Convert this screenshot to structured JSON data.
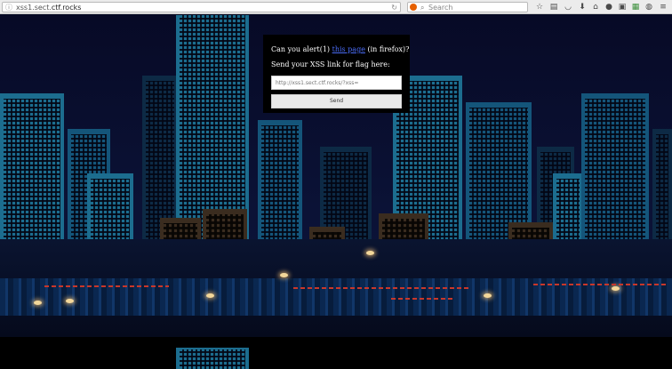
{
  "browser": {
    "url_prefix": "xss1.sect.",
    "url_domain": "ctf.rocks",
    "search_placeholder": "Search"
  },
  "form": {
    "question_before": "Can you alert(1)",
    "question_link": "this page",
    "question_after": "(in firefox)?",
    "prompt": "Send your XSS link for flag here:",
    "input_placeholder": "http://xss1.sect.ctf.rocks/?xss=",
    "input_value": "",
    "send_label": "Send"
  },
  "colors": {
    "link": "#4a6cf7",
    "panel_bg": "#000000"
  },
  "icons": {
    "toolbar": [
      "star-icon",
      "reading-list-icon",
      "pocket-icon",
      "download-icon",
      "home-icon",
      "chat-icon",
      "screenshot-icon",
      "sync-icon",
      "extension-icon",
      "menu-icon"
    ]
  }
}
